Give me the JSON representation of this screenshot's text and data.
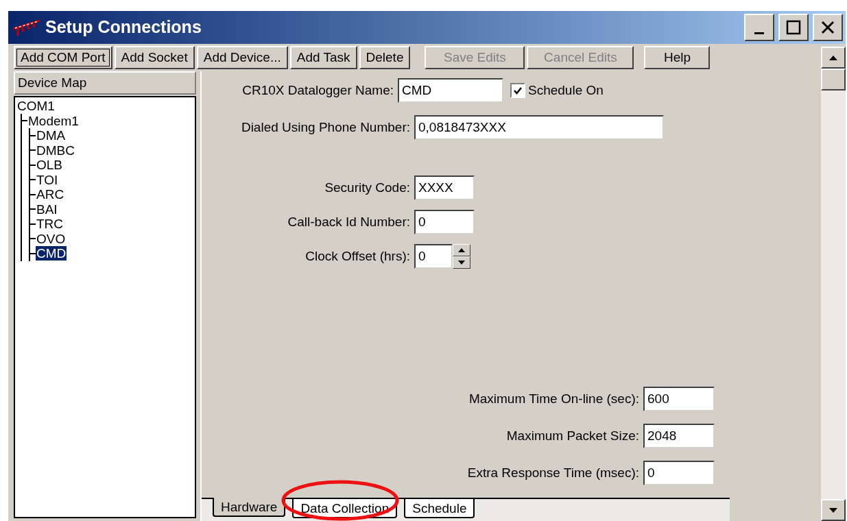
{
  "window": {
    "title": "Setup Connections"
  },
  "toolbar": [
    {
      "label": "Add COM Port",
      "disabled": false,
      "focused": true
    },
    {
      "label": "Add Socket",
      "disabled": false,
      "focused": false
    },
    {
      "label": "Add Device...",
      "disabled": false,
      "focused": false
    },
    {
      "label": "Add Task",
      "disabled": false,
      "focused": false
    },
    {
      "label": "Delete",
      "disabled": false,
      "focused": false
    },
    {
      "label": "Save Edits",
      "disabled": true,
      "focused": false
    },
    {
      "label": "Cancel Edits",
      "disabled": true,
      "focused": false
    },
    {
      "label": "Help",
      "disabled": false,
      "focused": false
    }
  ],
  "device_map": {
    "title": "Device Map",
    "tree": [
      {
        "label": "COM1",
        "selected": false,
        "children": [
          {
            "label": "Modem1",
            "selected": false,
            "children": [
              {
                "label": "DMA",
                "selected": false
              },
              {
                "label": "DMBC",
                "selected": false
              },
              {
                "label": "OLB",
                "selected": false
              },
              {
                "label": "TOI",
                "selected": false
              },
              {
                "label": "ARC",
                "selected": false
              },
              {
                "label": "BAI",
                "selected": false
              },
              {
                "label": "TRC",
                "selected": false
              },
              {
                "label": "OVO",
                "selected": false
              },
              {
                "label": "CMD",
                "selected": true
              }
            ]
          }
        ]
      }
    ]
  },
  "form": {
    "datalogger_name": {
      "label": "CR10X Datalogger Name:",
      "value": "CMD"
    },
    "schedule_on": {
      "label": "Schedule On",
      "checked": true
    },
    "phone_number": {
      "label": "Dialed Using Phone Number:",
      "value": "0,0818473XXX"
    },
    "security_code": {
      "label": "Security Code:",
      "value": "XXXX"
    },
    "callback_id": {
      "label": "Call-back Id Number:",
      "value": "0"
    },
    "clock_offset": {
      "label": "Clock Offset (hrs):",
      "value": "0"
    },
    "max_time_online": {
      "label": "Maximum Time On-line (sec):",
      "value": "600"
    },
    "max_packet_size": {
      "label": "Maximum Packet Size:",
      "value": "2048"
    },
    "extra_response_time": {
      "label": "Extra Response Time (msec):",
      "value": "0"
    }
  },
  "tabs": [
    {
      "label": "Hardware",
      "selected": true
    },
    {
      "label": "Data Collection",
      "selected": false
    },
    {
      "label": "Schedule",
      "selected": false
    }
  ]
}
